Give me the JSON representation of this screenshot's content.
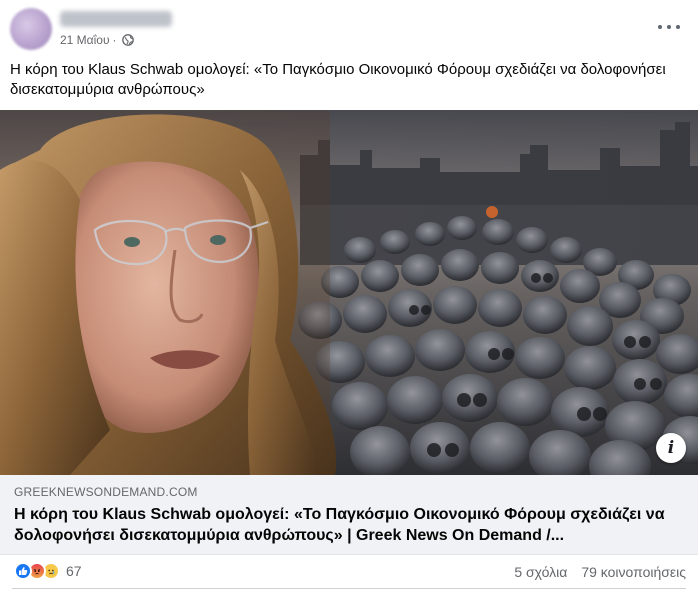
{
  "post": {
    "date": "21 Μαΐου",
    "separator": "·",
    "privacy_icon": "globe-icon",
    "menu_icon": "more-horizontal-icon",
    "text": "Η κόρη του Klaus Schwab ομολογεί: «Το Παγκόσμιο Οικονομικό Φόρουμ σχεδιάζει να δολοφονήσει δισεκατομμύρια ανθρώπους»"
  },
  "image": {
    "info_icon": "info-icon",
    "info_label": "i"
  },
  "link": {
    "domain": "GREEKNEWSONDEMAND.COM",
    "title": "Η κόρη του Klaus Schwab ομολογεί: «Το Παγκόσμιο Οικονομικό Φόρουμ σχεδιάζει να δολοφονήσει δισεκατομμύρια ανθρώπους» | Greek News On Demand /..."
  },
  "footer": {
    "reaction_icons": [
      "like-icon",
      "angry-icon",
      "sad-icon"
    ],
    "reaction_count": "67",
    "comments": "5 σχόλια",
    "shares": "79 κοινοποιήσεις"
  },
  "colors": {
    "accent": "#1877f2",
    "secondary_text": "#65676b",
    "link_bg": "#f0f2f5"
  }
}
